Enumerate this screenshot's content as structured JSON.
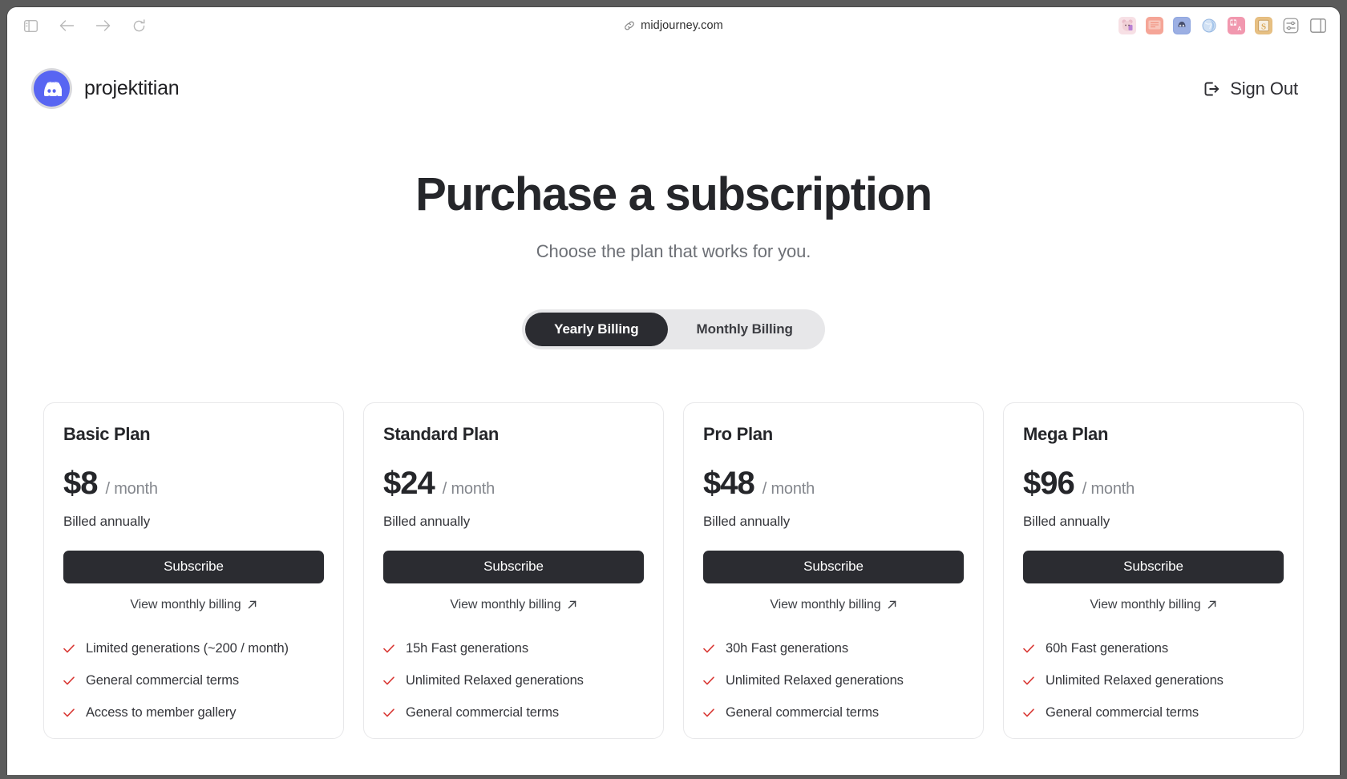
{
  "browser": {
    "url": "midjourney.com",
    "nav": {
      "sidebar_toggle": "sidebar-toggle",
      "back": "back",
      "forward": "forward",
      "reload": "reload"
    },
    "extensions": [
      {
        "name": "bear-character-extension",
        "label": "",
        "color": "#f3cfd6"
      },
      {
        "name": "notes-extension",
        "label": "",
        "color": "#f4a79a"
      },
      {
        "name": "profile-avatar-extension",
        "label": "",
        "color": "#5b6fb0"
      },
      {
        "name": "globe-extension",
        "label": "",
        "color": "#bcd4ef"
      },
      {
        "name": "translate-extension",
        "label": "中A",
        "color": "#f08ba4"
      },
      {
        "name": "s-extension",
        "label": "S",
        "color": "#e0b877"
      },
      {
        "name": "settings-sliders-extension",
        "label": "",
        "color": "#ffffff"
      },
      {
        "name": "side-panel-extension",
        "label": "",
        "color": "#ffffff"
      }
    ]
  },
  "header": {
    "brand_name": "projektitian",
    "avatar_icon": "discord-icon",
    "signout_label": "Sign Out",
    "signout_icon": "sign-out-icon"
  },
  "hero": {
    "title": "Purchase a subscription",
    "subtitle": "Choose the plan that works for you."
  },
  "billing_toggle": {
    "options": [
      {
        "label": "Yearly Billing",
        "active": true
      },
      {
        "label": "Monthly Billing",
        "active": false
      }
    ]
  },
  "plans": [
    {
      "name": "Basic Plan",
      "price": "$8",
      "period": "/ month",
      "billed_note": "Billed annually",
      "cta_label": "Subscribe",
      "alt_billing_label": "View monthly billing",
      "alt_billing_icon": "arrow-up-right-icon",
      "features": [
        "Limited generations (~200 / month)",
        "General commercial terms",
        "Access to member gallery"
      ]
    },
    {
      "name": "Standard Plan",
      "price": "$24",
      "period": "/ month",
      "billed_note": "Billed annually",
      "cta_label": "Subscribe",
      "alt_billing_label": "View monthly billing",
      "alt_billing_icon": "arrow-up-right-icon",
      "features": [
        "15h Fast generations",
        "Unlimited Relaxed generations",
        "General commercial terms"
      ]
    },
    {
      "name": "Pro Plan",
      "price": "$48",
      "period": "/ month",
      "billed_note": "Billed annually",
      "cta_label": "Subscribe",
      "alt_billing_label": "View monthly billing",
      "alt_billing_icon": "arrow-up-right-icon",
      "features": [
        "30h Fast generations",
        "Unlimited Relaxed generations",
        "General commercial terms"
      ]
    },
    {
      "name": "Mega Plan",
      "price": "$96",
      "period": "/ month",
      "billed_note": "Billed annually",
      "cta_label": "Subscribe",
      "alt_billing_label": "View monthly billing",
      "alt_billing_icon": "arrow-up-right-icon",
      "features": [
        "60h Fast generations",
        "Unlimited Relaxed generations",
        "General commercial terms"
      ]
    }
  ],
  "colors": {
    "accent_dark": "#2b2c31",
    "check_red": "#d93a36",
    "discord_blurple": "#5865f2",
    "muted_text": "#84878d"
  }
}
